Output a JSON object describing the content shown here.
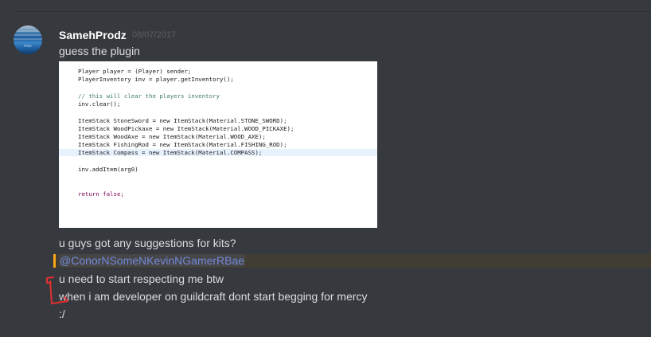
{
  "message": {
    "author": "SamehProdz",
    "timestamp": "08/07/2017",
    "avatar_label": "PRO",
    "lines": [
      "guess the plugin",
      "u guys got any suggestions for kits?",
      "u need to start respecting me btw",
      "when i am developer on guildcraft dont start begging for mercy",
      ":/"
    ],
    "mention": "@ConorNSomeNKevinNGamerRBae"
  },
  "code_image": {
    "lines": [
      "Player player = (Player) sender;",
      "PlayerInventory inv = player.getInventory();",
      "",
      "// this will clear the players inventory",
      "inv.clear();",
      "",
      "ItemStack StoneSword = new ItemStack(Material.STONE_SWORD);",
      "ItemStack WoodPickaxe = new ItemStack(Material.WOOD_PICKAXE);",
      "ItemStack WoodAxe = new ItemStack(Material.WOOD_AXE);",
      "ItemStack FishingRod = new ItemStack(Material.FISHING_ROD);",
      "ItemStack Compass = new ItemStack(Material.COMPASS);",
      "",
      "inv.addItem(arg0)",
      "",
      "",
      "return false;"
    ]
  },
  "colors": {
    "background": "#36393e",
    "mention_highlight": "#413d32",
    "mention_bar": "#faa61a",
    "mention_text": "#7289da",
    "annotation": "#e03030"
  }
}
